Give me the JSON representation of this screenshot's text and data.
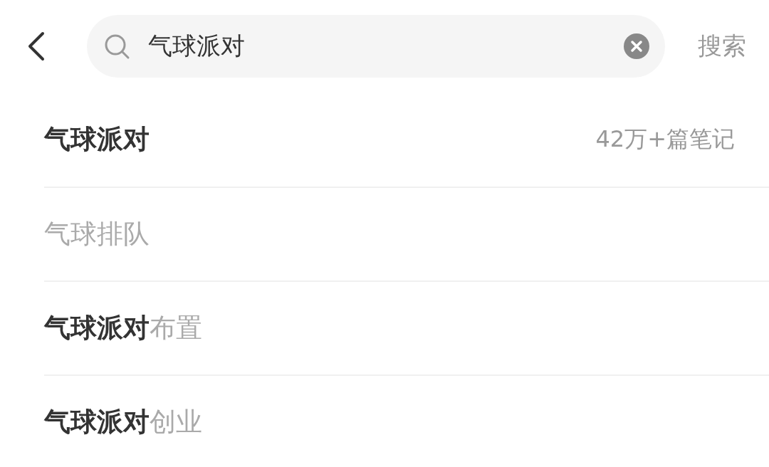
{
  "search": {
    "value": "气球派对",
    "button": "搜索"
  },
  "suggestions": [
    {
      "kind": "exact",
      "text": "气球派对",
      "count": "42万+篇笔记"
    },
    {
      "kind": "suggestion",
      "text": "气球排队"
    },
    {
      "kind": "suggestion",
      "text": "**气球派对**布置"
    },
    {
      "kind": "suggestion",
      "text": "**气球派对**创业"
    }
  ]
}
